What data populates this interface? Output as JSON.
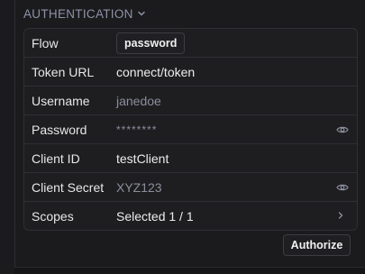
{
  "section": {
    "title": "AUTHENTICATION",
    "chevron_icon": "chevron-down-icon"
  },
  "rows": [
    {
      "label": "Flow",
      "value": "password"
    },
    {
      "label": "Token URL",
      "value": "connect/token"
    },
    {
      "label": "Username",
      "value": "janedoe"
    },
    {
      "label": "Password",
      "value": "********",
      "icon": "eye-icon"
    },
    {
      "label": "Client ID",
      "value": "testClient"
    },
    {
      "label": "Client Secret",
      "value": "XYZ123",
      "icon": "eye-icon"
    },
    {
      "label": "Scopes",
      "value": "Selected 1 / 1",
      "icon": "chevron-right-icon"
    }
  ],
  "authorize_label": "Authorize",
  "colors": {
    "background": "#1b1b1d",
    "section_title": "#8c93a8",
    "border": "#2f2f34",
    "muted_text": "#8a8f9c"
  }
}
